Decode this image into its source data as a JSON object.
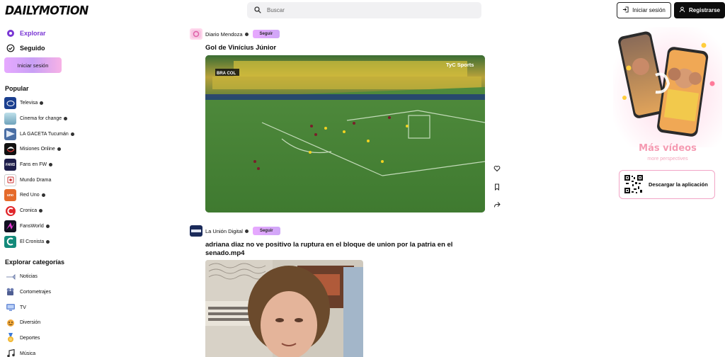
{
  "header": {
    "logo": "DAILYMOTION",
    "search_placeholder": "Buscar",
    "login_label": "Iniciar sesión",
    "register_label": "Registrarse"
  },
  "sidebar": {
    "nav": [
      {
        "label": "Explorar",
        "icon": "compass-icon",
        "active": true
      },
      {
        "label": "Seguido",
        "icon": "check-circle-icon",
        "active": false
      }
    ],
    "login_label": "Iniciar sesión",
    "popular_title": "Popular",
    "channels": [
      {
        "name": "Televisa",
        "color": "#1b3f8f"
      },
      {
        "name": "Cinema for change",
        "color": "#7fb2c9"
      },
      {
        "name": "LA GACETA Tucumán",
        "color": "#4a6fa5"
      },
      {
        "name": "Misiones Online",
        "color": "#111111"
      },
      {
        "name": "Fans en FW",
        "color": "#1d1d4a"
      },
      {
        "name": "Mundo Drama",
        "color": "#ffffff"
      },
      {
        "name": "Red Uno",
        "color": "#e56a2b"
      },
      {
        "name": "Cronica",
        "color": "#ffffff"
      },
      {
        "name": "FansWorld",
        "color": "#101020"
      },
      {
        "name": "El Cronista",
        "color": "#138a7a"
      }
    ],
    "categories_title": "Explorar categorías",
    "categories": [
      {
        "label": "Noticias",
        "icon": "newspaper-icon"
      },
      {
        "label": "Cortometrajes",
        "icon": "film-camera-icon"
      },
      {
        "label": "TV",
        "icon": "tv-icon"
      },
      {
        "label": "Diversión",
        "icon": "fun-icon"
      },
      {
        "label": "Deportes",
        "icon": "medal-icon"
      },
      {
        "label": "Música",
        "icon": "music-icon"
      }
    ]
  },
  "feed": {
    "posts": [
      {
        "channel": "Diario Mendoza",
        "follow_label": "Seguir",
        "title": "Gol de Vinícius Júnior",
        "overlay_brand": "TyC Sports",
        "scoreboard": "BRA COL"
      },
      {
        "channel": "La Unión Digital",
        "follow_label": "Seguir",
        "title": "adriana diaz no ve positivo la ruptura en el bloque de union por la patria en el senado.mp4"
      }
    ]
  },
  "promo": {
    "headline": "Más vídeos",
    "subline": "more perspectives",
    "download_label": "Descargar la aplicación"
  },
  "colors": {
    "accent": "#7a37d4",
    "follow_gradient_start": "#e8a8ff",
    "promo_pink": "#f59ab2"
  }
}
